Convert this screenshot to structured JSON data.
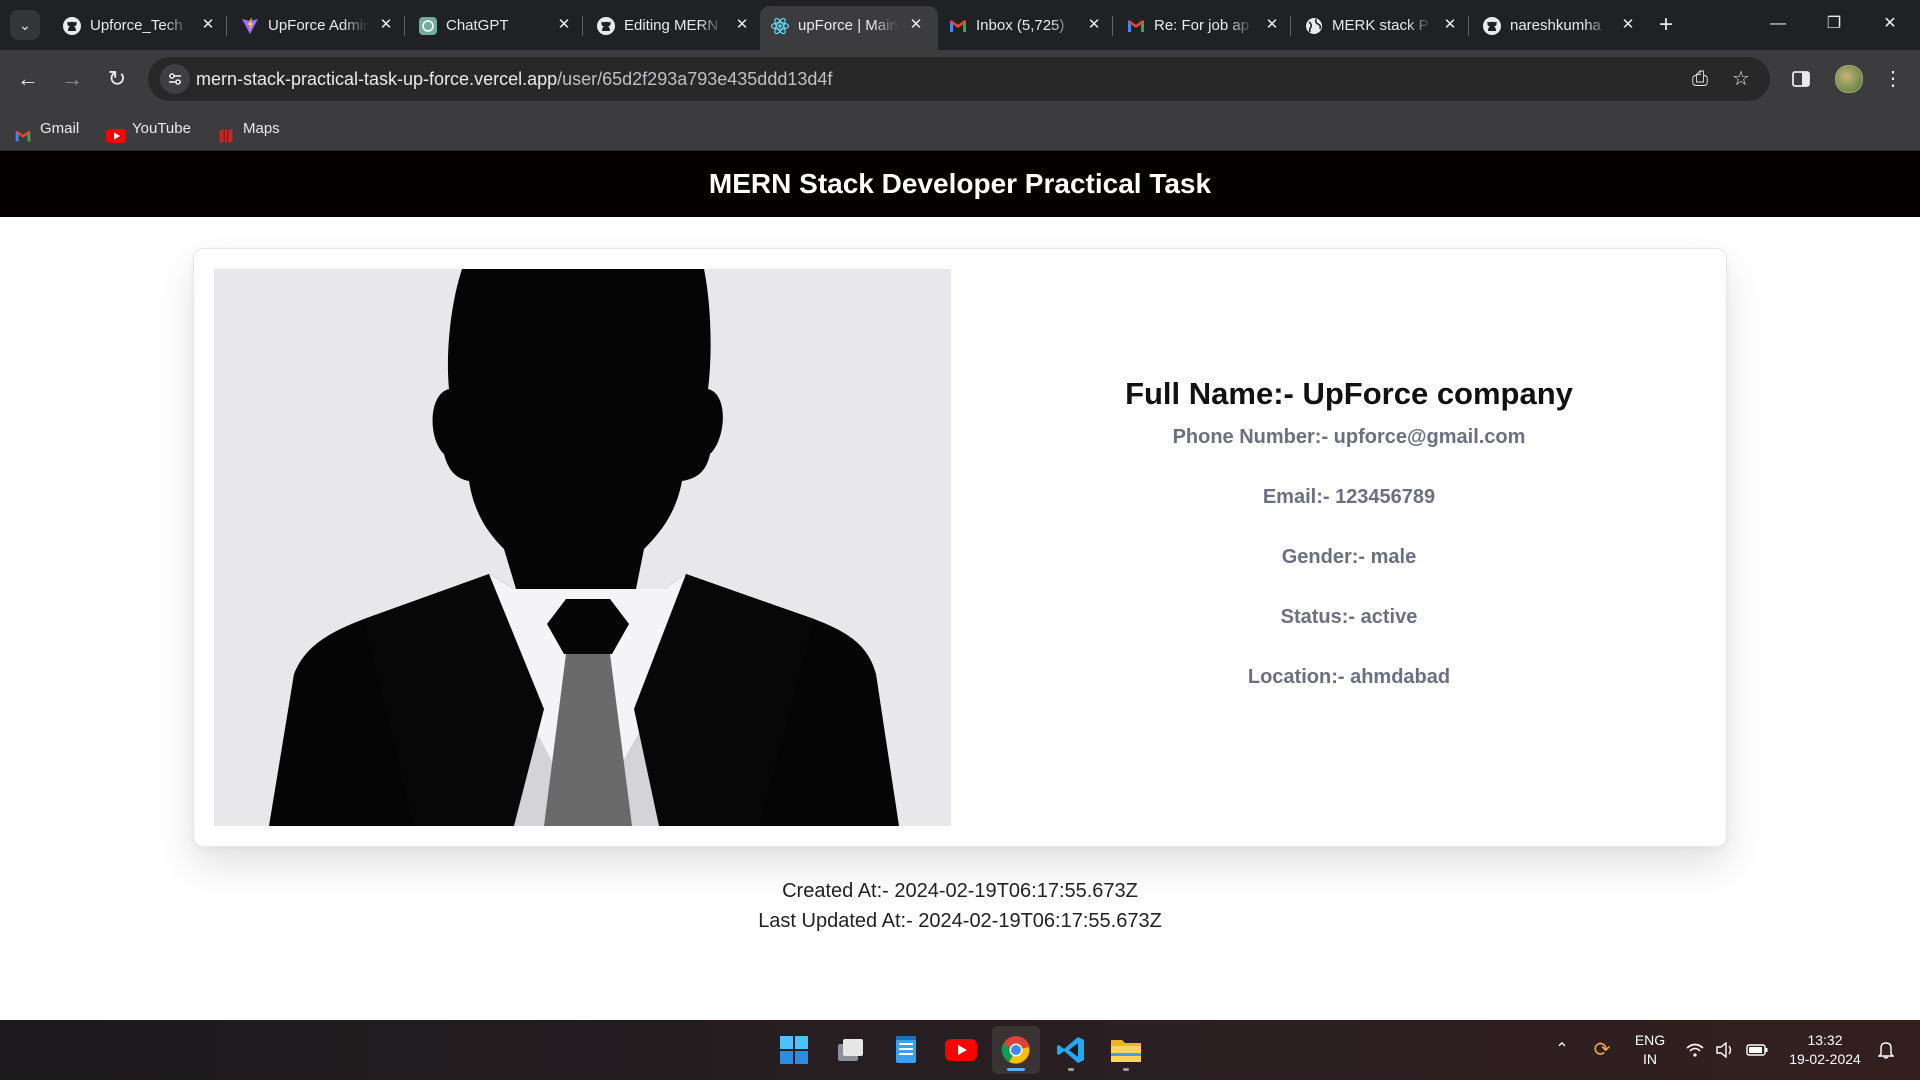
{
  "browser": {
    "tabs": [
      {
        "title": "Upforce_Tech",
        "icon": "github-icon",
        "active": false
      },
      {
        "title": "UpForce Admin",
        "icon": "vite-icon",
        "active": false
      },
      {
        "title": "ChatGPT",
        "icon": "chatgpt-icon",
        "active": false
      },
      {
        "title": "Editing MERN",
        "icon": "github-icon",
        "active": false
      },
      {
        "title": "upForce | Main",
        "icon": "react-icon",
        "active": true
      },
      {
        "title": "Inbox (5,725)",
        "icon": "gmail-icon",
        "active": false
      },
      {
        "title": "Re: For job ap",
        "icon": "gmail-icon",
        "active": false
      },
      {
        "title": "MERK stack P",
        "icon": "globe-icon",
        "active": false
      },
      {
        "title": "nareshkumha",
        "icon": "github-icon",
        "active": false
      }
    ],
    "address": {
      "host": "mern-stack-practical-task-up-force.vercel.app",
      "path": "/user/65d2f293a793e435ddd13d4f"
    },
    "bookmarks": [
      {
        "label": "Gmail",
        "icon": "gmail-icon"
      },
      {
        "label": "YouTube",
        "icon": "youtube-icon"
      },
      {
        "label": "Maps",
        "icon": "maps-icon"
      }
    ]
  },
  "page": {
    "header_title": "MERN Stack Developer Practical Task",
    "profile": {
      "full_name": "Full Name:- UpForce company",
      "phone": "Phone Number:- upforce@gmail.com",
      "email": "Email:- 123456789",
      "gender": "Gender:- male",
      "status": "Status:- active",
      "location": "Location:- ahmdabad"
    },
    "created_at": "Created At:- 2024-02-19T06:17:55.673Z",
    "updated_at": "Last Updated At:- 2024-02-19T06:17:55.673Z"
  },
  "taskbar": {
    "apps": [
      "windows-start-icon",
      "task-view-icon",
      "notepad-icon",
      "youtube-icon",
      "chrome-icon",
      "vscode-icon",
      "file-explorer-icon"
    ],
    "language": "ENG",
    "region": "IN",
    "time": "13:32",
    "date": "19-02-2024"
  },
  "colors": {
    "header_bg": "#050000",
    "label_gray": "#6b7080",
    "accent_blue": "#5ab0f7"
  }
}
